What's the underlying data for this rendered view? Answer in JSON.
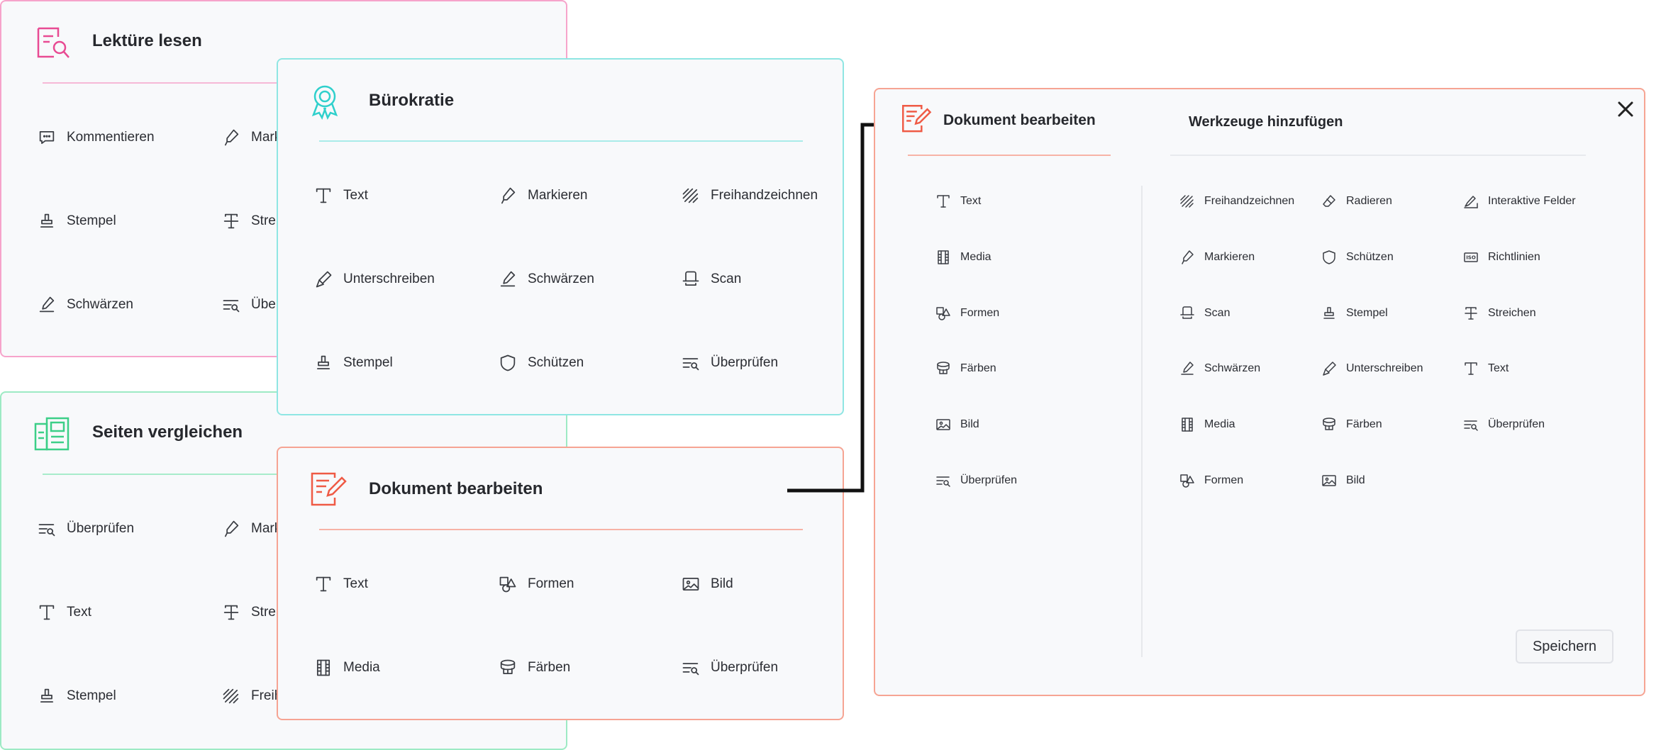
{
  "cards": {
    "lekture": {
      "title": "Lektüre lesen",
      "accent": "#f277b4",
      "tools": [
        "Kommentieren",
        "Mark",
        "Stempel",
        "Strei",
        "Schwärzen",
        "Über"
      ]
    },
    "seiten": {
      "title": "Seiten vergleichen",
      "accent": "#5fe0a2",
      "tools": [
        "Überprüfen",
        "Mark",
        "Text",
        "Strei",
        "Stempel",
        "Freih"
      ]
    },
    "buro": {
      "title": "Bürokratie",
      "accent": "#6fe3e0",
      "tools": [
        "Text",
        "Markieren",
        "Freihandzeichnen",
        "Unterschreiben",
        "Schwärzen",
        "Scan",
        "Stempel",
        "Schützen",
        "Überprüfen"
      ]
    },
    "doku": {
      "title": "Dokument bearbeiten",
      "accent": "#f28a78",
      "tools": [
        "Text",
        "Formen",
        "Bild",
        "Media",
        "Färben",
        "Überprüfen"
      ]
    }
  },
  "editor": {
    "title": "Dokument bearbeiten",
    "add_title": "Werkzeuge hinzufügen",
    "accent": "#f28a78",
    "selected_tools": [
      "Text",
      "Media",
      "Formen",
      "Färben",
      "Bild",
      "Überprüfen"
    ],
    "available_tools": [
      "Freihandzeichnen",
      "Radieren",
      "Interaktive Felder",
      "Markieren",
      "Schützen",
      "Richtlinien",
      "Scan",
      "Stempel",
      "Streichen",
      "Schwärzen",
      "Unterschreiben",
      "Text",
      "Media",
      "Färben",
      "Überprüfen",
      "Formen",
      "Bild"
    ],
    "save_label": "Speichern",
    "close_icon": "close-icon"
  },
  "icons": {
    "guideline_badge": "ISO"
  }
}
